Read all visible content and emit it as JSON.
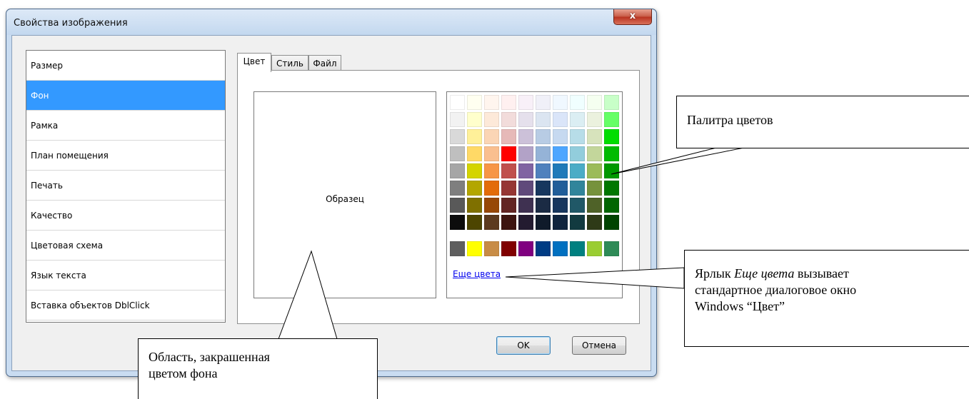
{
  "window": {
    "title": "Свойства изображения",
    "close_glyph": "x"
  },
  "categories": [
    "Размер",
    "Фон",
    "Рамка",
    "План помещения",
    "Печать",
    "Качество",
    "Цветовая схема",
    "Язык текста",
    "Вставка объектов DblClick"
  ],
  "selected_category": "Фон",
  "tabs": [
    {
      "label": "Цвет",
      "active": true
    },
    {
      "label": "Стиль",
      "active": false
    },
    {
      "label": "Файл",
      "active": false
    }
  ],
  "preview": {
    "label": "Образец"
  },
  "palette": {
    "rows": [
      [
        "#ffffff",
        "#fffff0",
        "#fff5ee",
        "#fff0f0",
        "#f8f0f8",
        "#f0f0f8",
        "#f0f8ff",
        "#f0ffff",
        "#f5fff0",
        "#c8ffc8"
      ],
      [
        "#f2f2f2",
        "#ffffcc",
        "#fde9d9",
        "#f2dcdb",
        "#e5e0ec",
        "#dbe5f1",
        "#dae5f9",
        "#dbeef3",
        "#ebf1de",
        "#66ff66"
      ],
      [
        "#d9d9d9",
        "#fff099",
        "#fbd5b5",
        "#e6b9b8",
        "#ccc1d9",
        "#b8cce4",
        "#c6d9f0",
        "#b7dde8",
        "#d7e3bc",
        "#00dd00"
      ],
      [
        "#bfbfbf",
        "#ffd966",
        "#fabf8f",
        "#ff0000",
        "#b2a2c7",
        "#95b3d7",
        "#4da6ff",
        "#92cddc",
        "#c3d69b",
        "#00bb00"
      ],
      [
        "#a6a6a6",
        "#d4d400",
        "#f79646",
        "#c0504d",
        "#8064a2",
        "#4f81bd",
        "#1f7ab9",
        "#4bacc6",
        "#9bbb59",
        "#009900"
      ],
      [
        "#7f7f7f",
        "#b3a600",
        "#e36c09",
        "#963634",
        "#604a7b",
        "#17375e",
        "#215e99",
        "#31859b",
        "#76923c",
        "#007700"
      ],
      [
        "#595959",
        "#7f7000",
        "#974806",
        "#632523",
        "#3f3151",
        "#1b2b44",
        "#17365d",
        "#205867",
        "#4f6228",
        "#006600"
      ],
      [
        "#0c0c0c",
        "#4d4500",
        "#5c3a1e",
        "#3d1410",
        "#231b30",
        "#0f1a2a",
        "#0f243e",
        "#123a40",
        "#2e3a17",
        "#004400"
      ]
    ],
    "standard_row": [
      "#5f5f5f",
      "#ffff00",
      "#c88c46",
      "#800000",
      "#800080",
      "#003c84",
      "#0070c0",
      "#008080",
      "#9acd32",
      "#2e8b57"
    ],
    "more_colors_link": "Еще цвета"
  },
  "buttons": {
    "ok": "OK",
    "cancel": "Отмена"
  },
  "callouts": {
    "palette": "Палитра цветов",
    "more_colors": [
      "Ярлык ",
      "Еще цвета",
      " вызывает",
      "стандартное диалоговое окно",
      "Windows “Цвет”"
    ],
    "sample_area": [
      "Область, закрашенная",
      "цветом фона"
    ]
  }
}
